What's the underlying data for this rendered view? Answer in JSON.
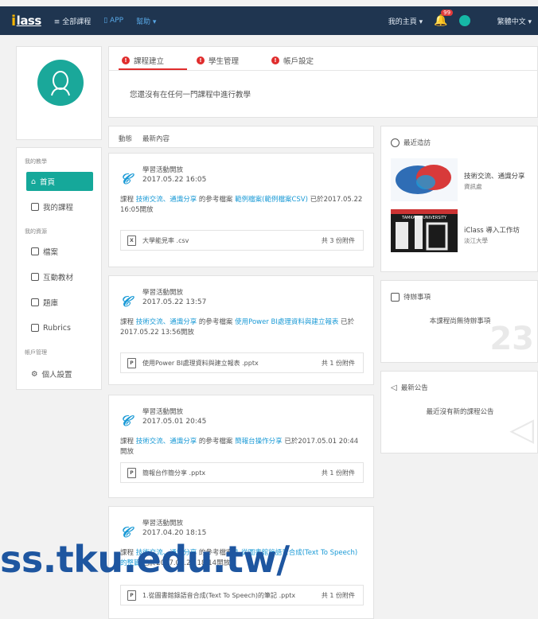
{
  "topbar": {
    "logo_i": "i",
    "logo_rest": "lass",
    "menu_all_courses": "≡ 全部課程",
    "app": "▯ APP",
    "help": "幫助 ▾",
    "my_home": "我的主頁 ▾",
    "bell_count": "99",
    "language": "繁體中文 ▾"
  },
  "sidebar": {
    "sec_teaching": "我的教學",
    "home": "首頁",
    "my_courses": "我的課程",
    "sec_resources": "我的資源",
    "files": "檔案",
    "interactive": "互動教材",
    "question_bank": "題庫",
    "rubrics": "Rubrics",
    "sec_account": "帳戶管理",
    "personal_settings": "個人設置"
  },
  "tabs": {
    "t1": "課程建立",
    "t2": "學生管理",
    "t3": "帳戶設定",
    "message": "您還沒有在任何一門課程中進行教學"
  },
  "feed": {
    "col1": "動態",
    "col2": "最新內容",
    "posts": [
      {
        "title": "學習活動開放",
        "date": "2017.05.22 16:05",
        "body_a": "課程 ",
        "course": "技術交流、通識分享",
        "body_b": " 的參考檔案 ",
        "file_link": "範例檔案(範例檔案CSV)",
        "body_c": " 已於2017.05.22 16:05開放",
        "attach_name": "大學能見率 .csv",
        "attach_count": "共 3 份附件",
        "attach_icon": "X"
      },
      {
        "title": "學習活動開放",
        "date": "2017.05.22 13:57",
        "body_a": "課程 ",
        "course": "技術交流、通識分享",
        "body_b": " 的參考檔案 ",
        "file_link": "使用Power BI處理資料與建立報表",
        "body_c": " 已於2017.05.22 13:56開放",
        "attach_name": "使用Power BI處理資料與建立報表 .pptx",
        "attach_count": "共 1 份附件",
        "attach_icon": "P"
      },
      {
        "title": "學習活動開放",
        "date": "2017.05.01 20:45",
        "body_a": "課程 ",
        "course": "技術交流、通識分享",
        "body_b": " 的參考檔案 ",
        "file_link": "簡報台操作分享",
        "body_c": " 已於2017.05.01 20:44開放",
        "attach_name": "簡報台作簡分享 .pptx",
        "attach_count": "共 1 份附件",
        "attach_icon": "P"
      },
      {
        "title": "學習活動開放",
        "date": "2017.04.20 18:15",
        "body_a": "課程 ",
        "course": "技術交流、通識分享",
        "body_b": " 的參考檔案 ",
        "file_link": "1.從圖書館錄語音合成(Text To Speech)的整篇",
        "body_c": " 已於2017.04.20 18:14開放",
        "attach_name": "1.從圖書館錄語音合成(Text To Speech)的筆記 .pptx",
        "attach_count": "共 1 份附件",
        "attach_icon": "P"
      }
    ]
  },
  "right": {
    "recent_title": "最近造訪",
    "course1_name": "技術交流、通識分享",
    "course1_owner": "資訊處",
    "course2_name": "iClass 導入工作坊",
    "course2_owner": "淡江大學",
    "tku_label": "TAMKANG UNIVERSITY",
    "todo_title": "待辦事項",
    "todo_msg": "本課程尚無待辦事項",
    "ann_title": "最新公告",
    "ann_msg": "最近沒有新的課程公告",
    "calendar_day": "23"
  },
  "watermark": "ss.tku.edu.tw/"
}
